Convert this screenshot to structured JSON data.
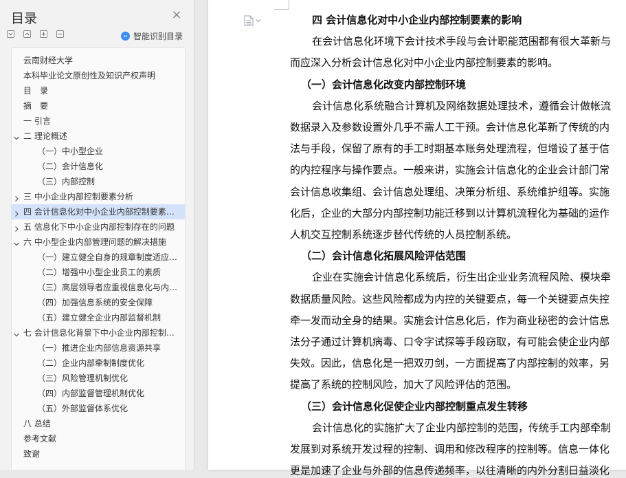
{
  "sidebar": {
    "title": "目录",
    "close_icon": "close-icon",
    "smart_label": "智能识别目录",
    "toc": [
      {
        "label": "云南财经大学",
        "level": 1,
        "arrow": ""
      },
      {
        "label": "本科毕业论文原创性及知识产权声明",
        "level": 1,
        "arrow": ""
      },
      {
        "label": "目　录",
        "level": 1,
        "arrow": ""
      },
      {
        "label": "摘　要",
        "level": 1,
        "arrow": ""
      },
      {
        "label": "一 引言",
        "level": 1,
        "arrow": ""
      },
      {
        "label": "二 理论概述",
        "level": 1,
        "arrow": "down"
      },
      {
        "label": "（一）中小型企业",
        "level": 2,
        "arrow": ""
      },
      {
        "label": "（二）会计信息化",
        "level": 2,
        "arrow": ""
      },
      {
        "label": "（三）内部控制",
        "level": 2,
        "arrow": ""
      },
      {
        "label": "三 中小企业内部控制要素分析",
        "level": 1,
        "arrow": "right"
      },
      {
        "label": "四 会计信息化对中小企业内部控制要素的影响",
        "level": 1,
        "arrow": "right",
        "selected": true
      },
      {
        "label": "五 信息化下中小企业内部控制存在的问题",
        "level": 1,
        "arrow": "right"
      },
      {
        "label": "六 中小型企业内部管理问题的解决措施",
        "level": 1,
        "arrow": "down"
      },
      {
        "label": "（一）建立健全自身的规章制度适应信息化",
        "level": 2,
        "arrow": ""
      },
      {
        "label": "（二）增强中小型企业员工的素质",
        "level": 2,
        "arrow": ""
      },
      {
        "label": "（三）高层领导者应重视信息化与内部控制",
        "level": 2,
        "arrow": ""
      },
      {
        "label": "（四）加强信息系统的安全保障",
        "level": 2,
        "arrow": ""
      },
      {
        "label": "（五）建立健全企业内部监督机制",
        "level": 2,
        "arrow": ""
      },
      {
        "label": "七 会计信息化背景下中小企业内部控制优化",
        "level": 1,
        "arrow": "down"
      },
      {
        "label": "（一）推进企业内部信息资源共享",
        "level": 2,
        "arrow": ""
      },
      {
        "label": "（二）企业内部牵制制度优化",
        "level": 2,
        "arrow": ""
      },
      {
        "label": "（三）风险管理机制优化",
        "level": 2,
        "arrow": ""
      },
      {
        "label": "（四）内部监督管理机制优化",
        "level": 2,
        "arrow": ""
      },
      {
        "label": "（五）外部监督体系优化",
        "level": 2,
        "arrow": ""
      },
      {
        "label": "八 总结",
        "level": 1,
        "arrow": ""
      },
      {
        "label": "参考文献",
        "level": 1,
        "arrow": ""
      },
      {
        "label": "致谢",
        "level": 1,
        "arrow": ""
      }
    ]
  },
  "document": {
    "lines": [
      {
        "text": "四  会计信息化对中小企业内部控制要素的影响",
        "heading": true,
        "indent": 1
      },
      {
        "text": "在会计信息化环境下会计技术手段与会计职能范围都有很大革新与",
        "indent": 1
      },
      {
        "text": "而应深入分析会计信息化对中小企业内部控制要素的影响。",
        "indent": 0
      },
      {
        "text": "（一）会计信息化改变内部控制环境",
        "heading": true,
        "indent": 0.5
      },
      {
        "text": "会计信息化系统融合计算机及网络数据处理技术，遵循会计做帐流",
        "indent": 1
      },
      {
        "text": "数据录入及参数设置外几乎不需人工干预。会计信息化革新了传统的内",
        "indent": 0
      },
      {
        "text": "法与手段，保留了原有的手工时期基本账务处理流程，但增设了基于信",
        "indent": 0
      },
      {
        "text": "的内控程序与操作要点。一般来讲，实施会计信息化的企业会计部门常",
        "indent": 0
      },
      {
        "text": "会计信息收集组、会计信息处理组、决策分析组、系统维护组等。实施",
        "indent": 0
      },
      {
        "text": "化后，企业的大部分内部控制功能迁移到以计算机流程化为基础的运作",
        "indent": 0
      },
      {
        "text": "人机交互控制系统逐步替代传统的人员控制系统。",
        "indent": 0
      },
      {
        "text": "（二）会计信息化拓展风险评估范围",
        "heading": true,
        "indent": 0.5
      },
      {
        "text": "企业在实施会计信息化系统后，衍生出企业业务流程风险、模块牵",
        "indent": 1
      },
      {
        "text": "数据质量风险。这些风险都成为内控的关键要点，每一个关键要点失控",
        "indent": 0
      },
      {
        "text": "牵一发而动全身的结果。实施会计信息化后，作为商业秘密的会计信息",
        "indent": 0
      },
      {
        "text": "法分子通过计算机病毒、口令字试探等手段窃取，有可能会使企业内部",
        "indent": 0
      },
      {
        "text": "失效。因此，信息化是一把双刃剑，一方面提高了内部控制的效率，另",
        "indent": 0
      },
      {
        "text": "提高了系统的控制风险，加大了风险评估的范围。",
        "indent": 0
      },
      {
        "text": "（三）会计信息化促使企业内部控制重点发生转移",
        "heading": true,
        "indent": 0.5
      },
      {
        "text": "会计信息化的实施扩大了企业内部控制的范围，传统手工内部牵制",
        "indent": 1
      },
      {
        "text": "发展到对系统开发过程的控制、调用和修改程序的控制等。信息一体化",
        "indent": 0
      },
      {
        "text": "更是加速了企业与外部的信息传递频率，以往清晰的内外分割日益淡化",
        "indent": 0
      }
    ]
  }
}
